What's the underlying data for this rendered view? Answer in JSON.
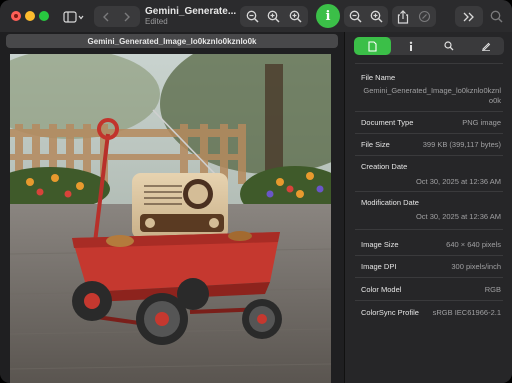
{
  "window": {
    "title": "Gemini_Generate...",
    "subtitle": "Edited"
  },
  "toolbar": {
    "icons": [
      "sidebar-icon",
      "back-icon",
      "forward-icon",
      "zoom-out-icon",
      "zoom-in-icon",
      "info-icon",
      "share-icon",
      "markup-icon",
      "more-icon",
      "search-icon"
    ],
    "info_label": "i",
    "accent": "#3bbf48"
  },
  "image": {
    "filename": "Gemini_Generated_Image_lo0kznlo0kznlo0k"
  },
  "inspector": {
    "tabs": [
      "general-info",
      "more-info",
      "image-details",
      "annotations"
    ],
    "active_tab": "general-info",
    "rows": {
      "file_name": {
        "label": "File Name",
        "value": "Gemini_Generated_Image_lo0kznlo0kznlo0k"
      },
      "document_type": {
        "label": "Document Type",
        "value": "PNG image"
      },
      "file_size": {
        "label": "File Size",
        "value": "399 KB (399,117 bytes)"
      },
      "creation_date": {
        "label": "Creation Date",
        "value": "Oct 30, 2025 at 12:36 AM"
      },
      "modification_date": {
        "label": "Modification Date",
        "value": "Oct 30, 2025 at 12:36 AM"
      },
      "image_size": {
        "label": "Image Size",
        "value": "640 × 640 pixels"
      },
      "image_dpi": {
        "label": "Image DPI",
        "value": "300 pixels/inch"
      },
      "color_model": {
        "label": "Color Model",
        "value": "RGB"
      },
      "colorsync_profile": {
        "label": "ColorSync Profile",
        "value": "sRGB IEC61966-2.1"
      }
    }
  }
}
